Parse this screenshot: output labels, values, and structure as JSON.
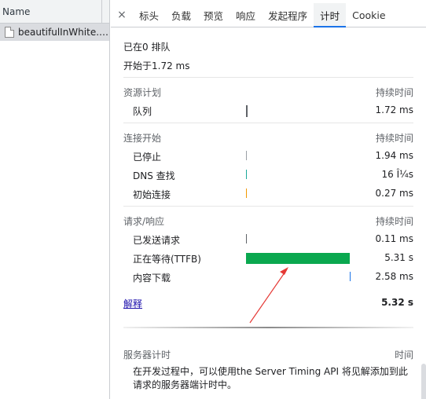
{
  "request_list": {
    "header": "Name",
    "items": [
      {
        "name": "beautifulInWhite.json"
      }
    ]
  },
  "tabs": [
    {
      "id": "close",
      "label": "×"
    },
    {
      "id": "headers",
      "label": "标头"
    },
    {
      "id": "payload",
      "label": "负载"
    },
    {
      "id": "preview",
      "label": "预览"
    },
    {
      "id": "response",
      "label": "响应"
    },
    {
      "id": "initiator",
      "label": "发起程序"
    },
    {
      "id": "timing",
      "label": "计时"
    },
    {
      "id": "cookie",
      "label": "Cookie"
    }
  ],
  "timing": {
    "queued_at": "已在0 排队",
    "started_at": "开始于1.72 ms",
    "sections": [
      {
        "title": "资源计划",
        "duration_header": "持续时间",
        "rows": [
          {
            "label": "队列",
            "value": "1.72 ms",
            "bar_color": "#5f6368",
            "fill_start": 0.0,
            "fill_width": 0.0
          }
        ]
      },
      {
        "title": "连接开始",
        "duration_header": "持续时间",
        "rows": [
          {
            "label": "已停止",
            "value": "1.94 ms",
            "bar_color": "#9aa0a6",
            "fill_start": 0.0,
            "fill_width": 0.0
          },
          {
            "label": "DNS 查找",
            "value": "16 Î¼s",
            "bar_color": "#1aa89a",
            "fill_start": 0.0,
            "fill_width": 0.0
          },
          {
            "label": "初始连接",
            "value": "0.27 ms",
            "bar_color": "#f29900",
            "fill_start": 0.0,
            "fill_width": 0.0
          }
        ]
      },
      {
        "title": "请求/响应",
        "duration_header": "持续时间",
        "rows": [
          {
            "label": "已发送请求",
            "value": "0.11 ms",
            "bar_color": "#5f6368",
            "fill_start": 0.0,
            "fill_width": 0.0
          },
          {
            "label": "正在等待(TTFB)",
            "value": "5.31 s",
            "bar_color": "#0aa84f",
            "fill_start": 0.0,
            "fill_width": 0.998
          },
          {
            "label": "内容下载",
            "value": "2.58 ms",
            "bar_color": "#1a73e8",
            "fill_start": 0.998,
            "fill_width": 0.0
          }
        ]
      }
    ],
    "explanation_link": "解释",
    "total": "5.32 s",
    "server_timing": {
      "title": "服务器计时",
      "time_header": "时间",
      "description": "在开发过程中，可以使用the Server Timing API 将见解添加到此请求的服务器端计时中。"
    }
  },
  "colors": {
    "accent": "#1a73e8",
    "annotation_arrow": "#e53935"
  }
}
